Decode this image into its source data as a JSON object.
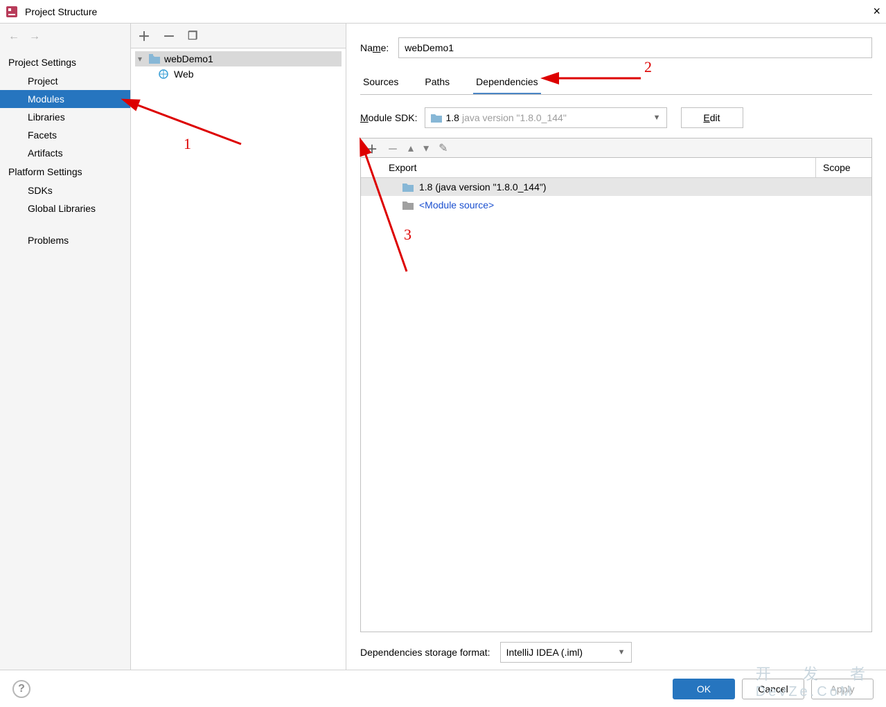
{
  "window": {
    "title": "Project Structure",
    "close": "×"
  },
  "nav": {
    "section1": "Project Settings",
    "items1": [
      "Project",
      "Modules",
      "Libraries",
      "Facets",
      "Artifacts"
    ],
    "selected1": "Modules",
    "section2": "Platform Settings",
    "items2": [
      "SDKs",
      "Global Libraries"
    ],
    "section3": "Problems"
  },
  "tree": {
    "root": "webDemo1",
    "child": "Web"
  },
  "detail": {
    "name_label": "Name:",
    "name_value": "webDemo1",
    "tabs": {
      "sources": "Sources",
      "paths": "Paths",
      "dependencies": "Dependencies",
      "active": "Dependencies"
    },
    "sdk_label": "Module SDK:",
    "sdk_value": "1.8",
    "sdk_suffix": "java version \"1.8.0_144\"",
    "edit_label": "Edit",
    "dep_header": {
      "export": "Export",
      "scope": "Scope"
    },
    "deps": [
      {
        "label": "1.8 (java version \"1.8.0_144\")",
        "selected": true
      },
      {
        "label": "<Module source>",
        "link": true
      }
    ],
    "storage_label": "Dependencies storage format:",
    "storage_value": "IntelliJ IDEA (.iml)"
  },
  "footer": {
    "ok": "OK",
    "cancel": "Cancel",
    "apply": "Apply"
  },
  "annotations": {
    "n1": "1",
    "n2": "2",
    "n3": "3"
  },
  "watermark": {
    "line1": "开 发 者",
    "line2": "DevZe.CoM"
  }
}
